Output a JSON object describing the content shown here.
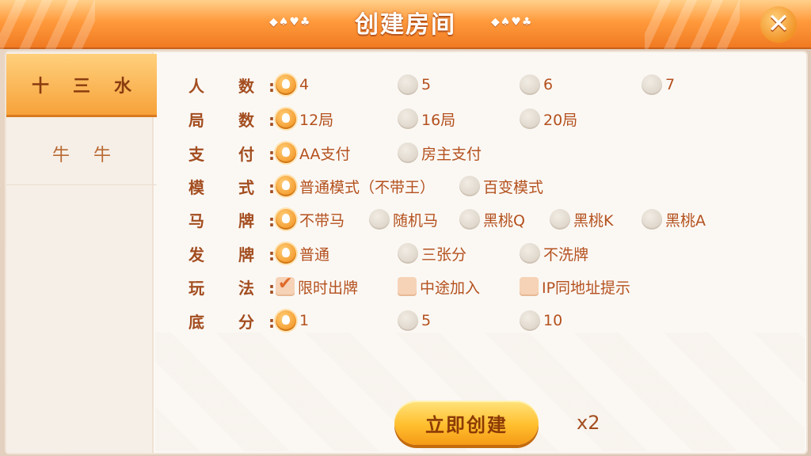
{
  "header": {
    "title": "创建房间",
    "suits_left": "◆♠♥♣",
    "suits_right": "◆♠♥♣",
    "close_symbol": "✕"
  },
  "sidebar": {
    "tabs": [
      {
        "label": "十三水",
        "active": true
      },
      {
        "label": "牛牛",
        "active": false
      }
    ]
  },
  "options": {
    "players": {
      "label": "人 数:",
      "choices": [
        "4",
        "5",
        "6",
        "7"
      ],
      "selected": "4"
    },
    "rounds": {
      "label": "局 数:",
      "choices": [
        "12局",
        "16局",
        "20局"
      ],
      "selected": "12局"
    },
    "payment": {
      "label": "支 付:",
      "choices": [
        "AA支付",
        "房主支付"
      ],
      "selected": "AA支付"
    },
    "mode": {
      "label": "模 式:",
      "choices": [
        "普通模式（不带王）",
        "百变模式"
      ],
      "selected": "普通模式（不带王）"
    },
    "horse_card": {
      "label": "马 牌:",
      "choices": [
        "不带马",
        "随机马",
        "黑桃Q",
        "黑桃K",
        "黑桃A"
      ],
      "selected": "不带马"
    },
    "deal": {
      "label": "发 牌:",
      "choices": [
        "普通",
        "三张分",
        "不洗牌"
      ],
      "selected": "普通"
    },
    "rules": {
      "label": "玩 法:",
      "choices": [
        "限时出牌",
        "中途加入",
        "IP同地址提示"
      ],
      "checked": [
        "限时出牌"
      ]
    },
    "base_score": {
      "label": "底 分:",
      "choices": [
        "1",
        "5",
        "10"
      ],
      "selected": "1"
    }
  },
  "actions": {
    "create_label": "立即创建",
    "cost": "x2"
  },
  "colors": {
    "accent": "#f49a2c",
    "label_text": "#a34d1f",
    "header": "#f07a22"
  }
}
